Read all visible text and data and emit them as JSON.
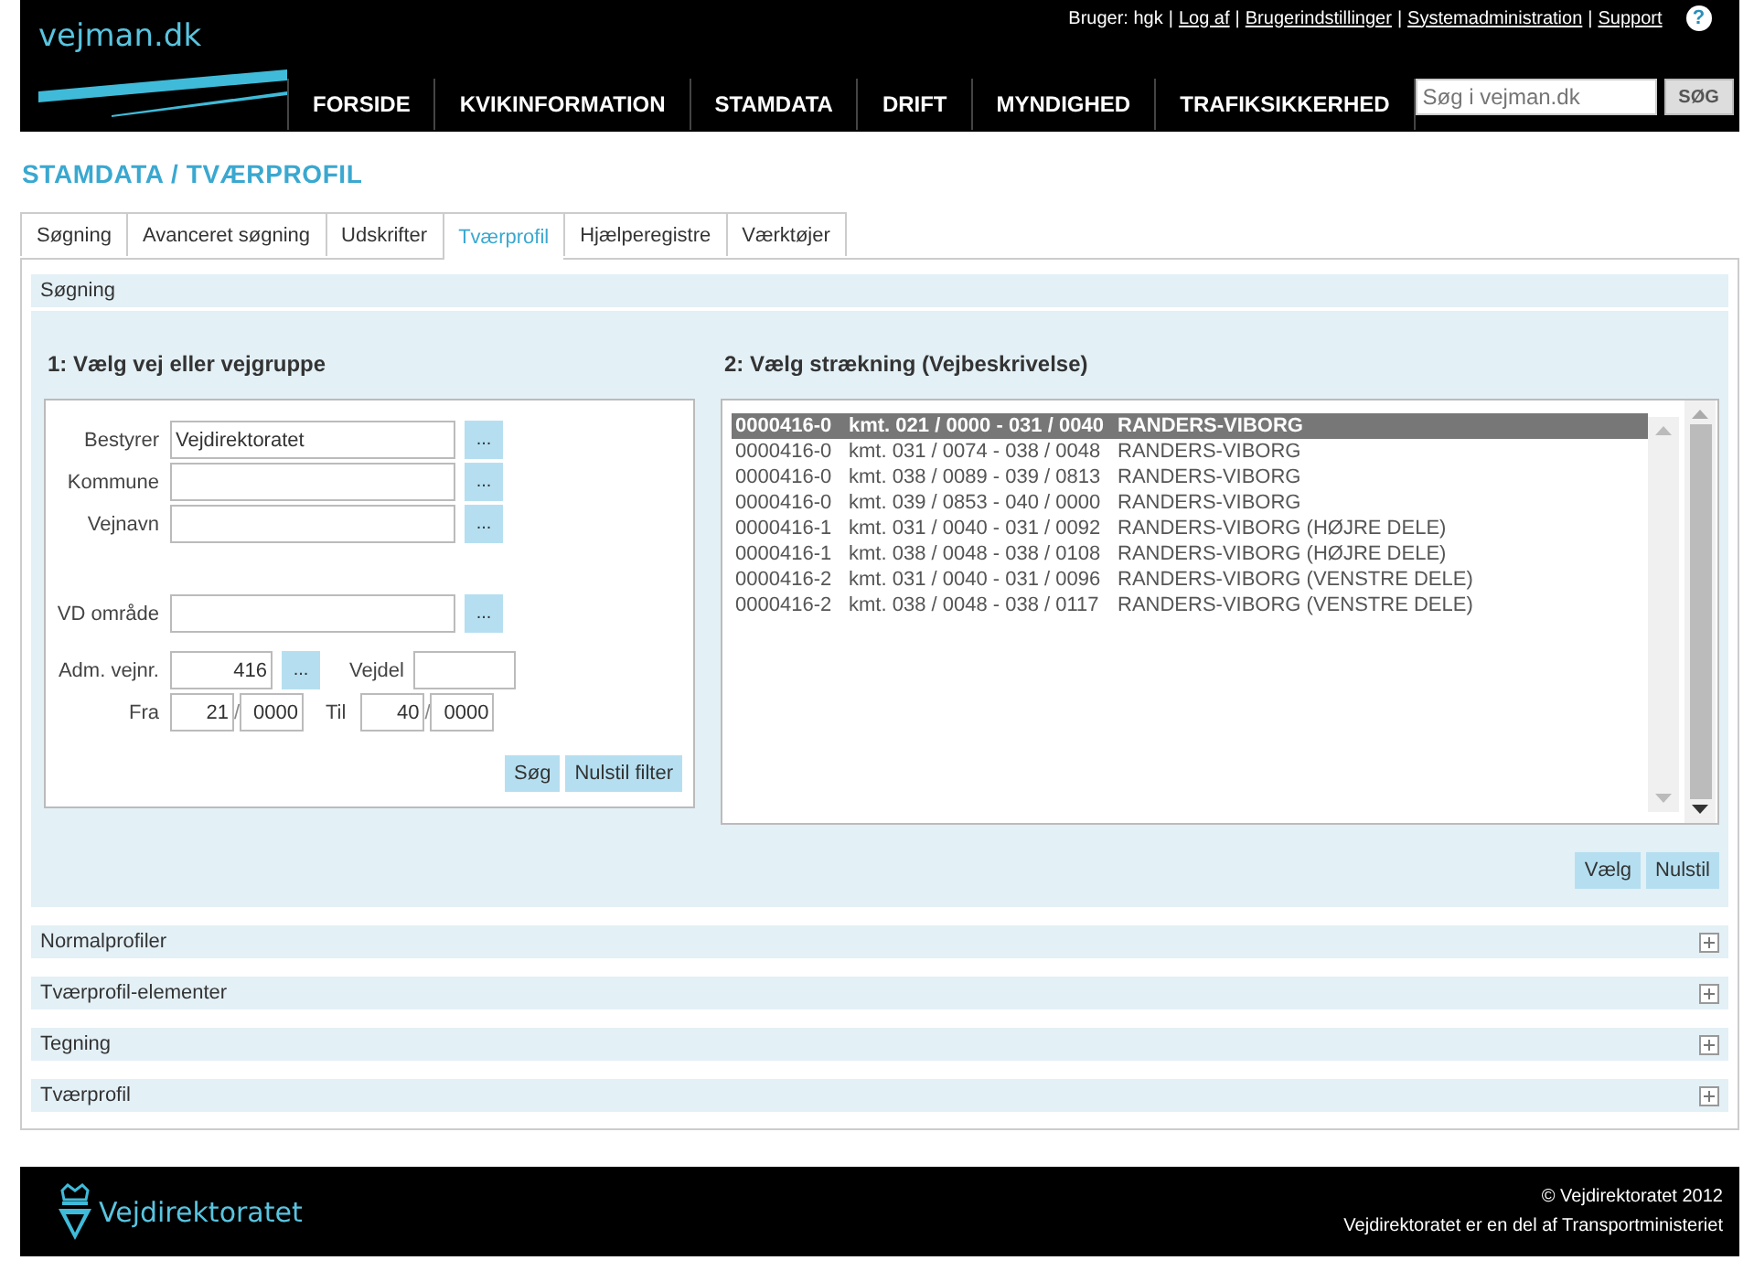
{
  "header": {
    "logo": "vejman.dk",
    "user_label": "Bruger: hgk",
    "link_separator": "|",
    "links": [
      "Log af",
      "Brugerindstillinger",
      "Systemadministration",
      "Support"
    ],
    "help": "?",
    "nav": [
      "FORSIDE",
      "KVIKINFORMATION",
      "STAMDATA",
      "DRIFT",
      "MYNDIGHED",
      "TRAFIKSIKKERHED"
    ],
    "search": {
      "placeholder": "Søg i vejman.dk",
      "button": "SØG"
    }
  },
  "page_title": "STAMDATA / TVÆRPROFIL",
  "tabs": [
    {
      "label": "Søgning",
      "selected": false
    },
    {
      "label": "Avanceret søgning",
      "selected": false
    },
    {
      "label": "Udskrifter",
      "selected": false
    },
    {
      "label": "Tværprofil",
      "selected": true
    },
    {
      "label": "Hjælperegistre",
      "selected": false
    },
    {
      "label": "Værktøjer",
      "selected": false
    }
  ],
  "search_panel": {
    "title": "Søgning",
    "left": {
      "heading": "1: Vælg vej eller vejgruppe",
      "fields": [
        {
          "label": "Bestyrer",
          "value": "Vejdirektoratet",
          "button": "..."
        },
        {
          "label": "Kommune",
          "button": "..."
        },
        {
          "label": "Vejnavn",
          "button": "..."
        },
        {
          "label": "VD område",
          "button": "..."
        }
      ],
      "adm": {
        "label": "Adm. vejnr.",
        "value": "416",
        "button": "...",
        "vejdel_label": "Vejdel"
      },
      "range": {
        "from_label": "Fra",
        "from_km": "21",
        "from_m": "0000",
        "to_label": "Til",
        "to_km": "40",
        "to_m": "0000",
        "separator": "/"
      },
      "buttons": [
        "Søg",
        "Nulstil filter"
      ]
    },
    "right": {
      "heading": "2: Vælg strækning (Vejbeskrivelse)",
      "rows": [
        {
          "road": "0000416-0",
          "km": "kmt. 021 / 0000 - 031 / 0040",
          "name": "RANDERS-VIBORG",
          "selected": true
        },
        {
          "road": "0000416-0",
          "km": "kmt. 031 / 0074 - 038 / 0048",
          "name": "RANDERS-VIBORG",
          "selected": false
        },
        {
          "road": "0000416-0",
          "km": "kmt. 038 / 0089 - 039 / 0813",
          "name": "RANDERS-VIBORG",
          "selected": false
        },
        {
          "road": "0000416-0",
          "km": "kmt. 039 / 0853 - 040 / 0000",
          "name": "RANDERS-VIBORG",
          "selected": false
        },
        {
          "road": "0000416-1",
          "km": "kmt. 031 / 0040 - 031 / 0092",
          "name": "RANDERS-VIBORG (HØJRE DELE)",
          "selected": false
        },
        {
          "road": "0000416-1",
          "km": "kmt. 038 / 0048 - 038 / 0108",
          "name": "RANDERS-VIBORG (HØJRE DELE)",
          "selected": false
        },
        {
          "road": "0000416-2",
          "km": "kmt. 031 / 0040 - 031 / 0096",
          "name": "RANDERS-VIBORG (VENSTRE DELE)",
          "selected": false
        },
        {
          "road": "0000416-2",
          "km": "kmt. 038 / 0048 - 038 / 0117",
          "name": "RANDERS-VIBORG (VENSTRE DELE)",
          "selected": false
        }
      ],
      "buttons": [
        "Vælg",
        "Nulstil"
      ]
    }
  },
  "sections": [
    {
      "title": "Normalprofiler",
      "expanded": false
    },
    {
      "title": "Tværprofil-elementer",
      "expanded": false
    },
    {
      "title": "Tegning",
      "expanded": false
    },
    {
      "title": "Tværprofil",
      "expanded": false
    }
  ],
  "footer": {
    "logo": "Vejdirektoratet",
    "copyright": "© Vejdirektoratet 2012",
    "note": "Vejdirektoratet er en del af Transportministeriet"
  }
}
